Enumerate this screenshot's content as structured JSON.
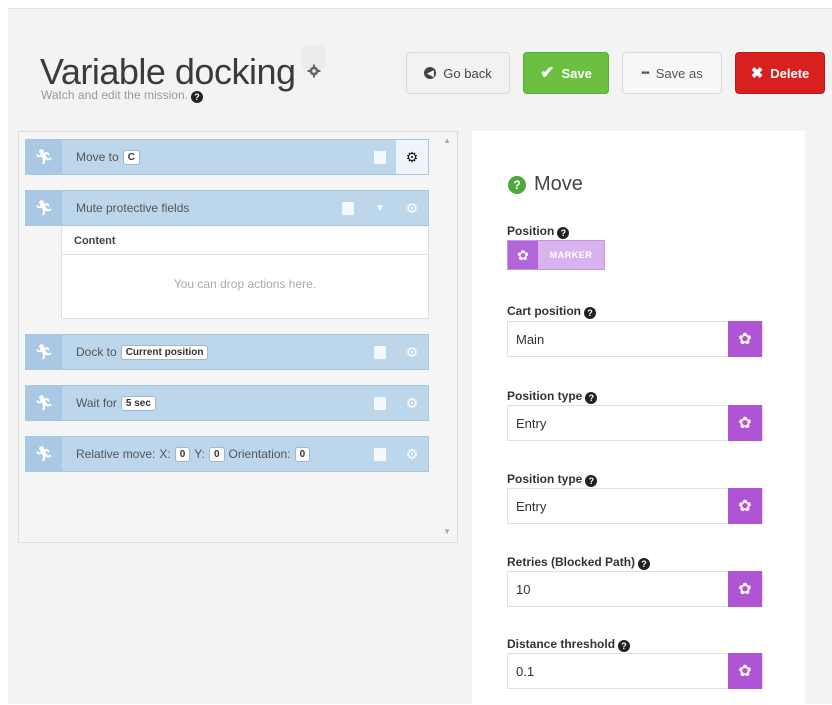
{
  "header": {
    "title": "Variable docking",
    "subtitle": "Watch and edit the mission."
  },
  "buttons": {
    "go_back": "Go back",
    "save": "Save",
    "save_as": "Save as",
    "delete": "Delete"
  },
  "mission": {
    "actions": [
      {
        "label": "Move to",
        "param": "C"
      },
      {
        "label": "Mute protective fields"
      },
      {
        "label": "Dock to",
        "param": "Current position"
      },
      {
        "label": "Wait for",
        "param": "5 sec"
      },
      {
        "label": "Relative move:",
        "x_label": "X:",
        "x": "0",
        "y_label": "Y:",
        "y": "0",
        "o_label": "Orientation:",
        "o": "0"
      }
    ],
    "content_header": "Content",
    "drop_text": "You can drop actions here."
  },
  "editor": {
    "title": "Move",
    "position_label": "Position",
    "marker_label": "MARKER",
    "cart_position_label": "Cart position",
    "cart_position_value": "Main",
    "position_type_label_1": "Position type",
    "position_type_value_1": "Entry",
    "position_type_label_2": "Position type",
    "position_type_value_2": "Entry",
    "retries_label": "Retries (Blocked Path)",
    "retries_value": "10",
    "distance_label": "Distance threshold",
    "distance_value": "0.1"
  },
  "colors": {
    "save": "#6cc041",
    "delete": "#d8201f",
    "action_bg": "#bcd6ec",
    "variable": "#b054d6"
  }
}
